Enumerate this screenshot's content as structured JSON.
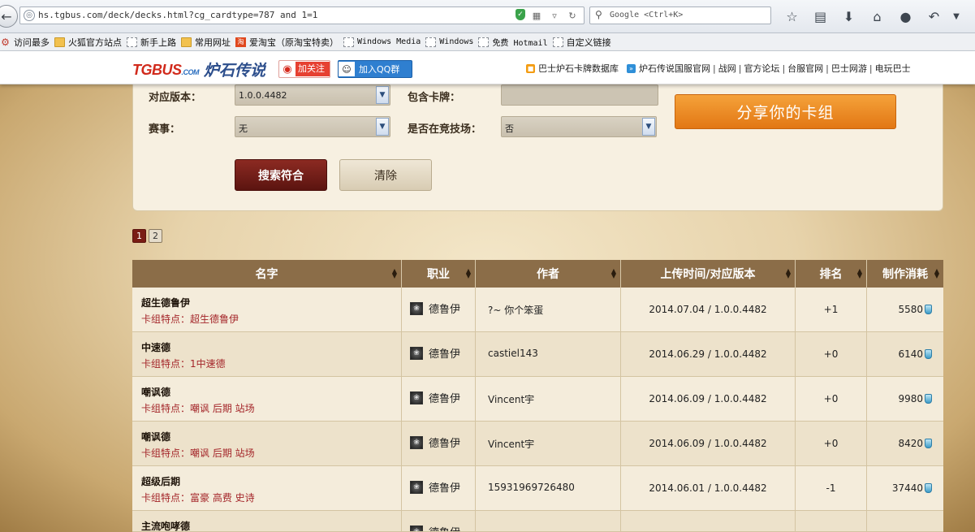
{
  "browser": {
    "url": "hs.tgbus.com/deck/decks.html?cg_cardtype=787 and 1=1",
    "search_placeholder": "Google <Ctrl+K>",
    "toolbar_icons": [
      "bookmark-star-icon",
      "reading-list-icon",
      "download-icon",
      "home-icon",
      "chat-icon",
      "undo-icon",
      "menu-chevron-icon"
    ],
    "bookmarks": [
      {
        "label": "访问最多",
        "icon": "gear-icon"
      },
      {
        "label": "火狐官方站点",
        "icon": "folder-icon"
      },
      {
        "label": "新手上路",
        "icon": "page-icon"
      },
      {
        "label": "常用网址",
        "icon": "folder-icon"
      },
      {
        "label": "爱淘宝（原淘宝特卖）",
        "icon": "taobao-icon"
      },
      {
        "label": "Windows Media",
        "icon": "page-icon"
      },
      {
        "label": "Windows",
        "icon": "page-icon"
      },
      {
        "label": "免费 Hotmail",
        "icon": "page-icon"
      },
      {
        "label": "自定义链接",
        "icon": "page-icon"
      }
    ]
  },
  "site_header": {
    "logo_main": "TGBUS",
    "logo_suffix": ".COM",
    "game_title": "炉石传说",
    "weibo_label": "加关注",
    "qq_label": "加入QQ群",
    "links": [
      "巴士炉石卡牌数据库",
      "炉石传说国服官网",
      "战网",
      "官方论坛",
      "台服官网",
      "巴士网游",
      "电玩巴士"
    ]
  },
  "filters": {
    "version_label": "对应版本：",
    "version_value": "1.0.0.4482",
    "contains_card_label": "包含卡牌：",
    "contains_card_value": "",
    "event_label": "赛事：",
    "event_value": "无",
    "arena_label": "是否在竞技场：",
    "arena_value": "否",
    "share_button": "分享你的卡组",
    "search_button": "搜索符合",
    "clear_button": "清除"
  },
  "pagination": {
    "pages": [
      "1",
      "2"
    ],
    "current": "1"
  },
  "table": {
    "headers": [
      "名字",
      "职业",
      "作者",
      "上传时间/对应版本",
      "排名",
      "制作消耗"
    ],
    "rows": [
      {
        "name": "超生德鲁伊",
        "features": "卡组特点：超生德鲁伊",
        "class": "德鲁伊",
        "author": "?~ 你个笨蛋",
        "upload": "2014.07.04 / 1.0.0.4482",
        "rank": "+1",
        "cost": "5580"
      },
      {
        "name": "中速德",
        "features": "卡组特点：1中速德",
        "class": "德鲁伊",
        "author": "castiel143",
        "upload": "2014.06.29 / 1.0.0.4482",
        "rank": "+0",
        "cost": "6140"
      },
      {
        "name": "嘲讽德",
        "features": "卡组特点：嘲讽 后期 站场",
        "class": "德鲁伊",
        "author": "Vincent宇",
        "upload": "2014.06.09 / 1.0.0.4482",
        "rank": "+0",
        "cost": "9980"
      },
      {
        "name": "嘲讽德",
        "features": "卡组特点：嘲讽 后期 站场",
        "class": "德鲁伊",
        "author": "Vincent宇",
        "upload": "2014.06.09 / 1.0.0.4482",
        "rank": "+0",
        "cost": "8420"
      },
      {
        "name": "超级后期",
        "features": "卡组特点：富豪 高费 史诗",
        "class": "德鲁伊",
        "author": "15931969726480",
        "upload": "2014.06.01 / 1.0.0.4482",
        "rank": "-1",
        "cost": "37440"
      },
      {
        "name": "主流咆哮德",
        "features": "",
        "class": "德鲁伊",
        "author": "",
        "upload": "",
        "rank": "",
        "cost": ""
      }
    ]
  }
}
